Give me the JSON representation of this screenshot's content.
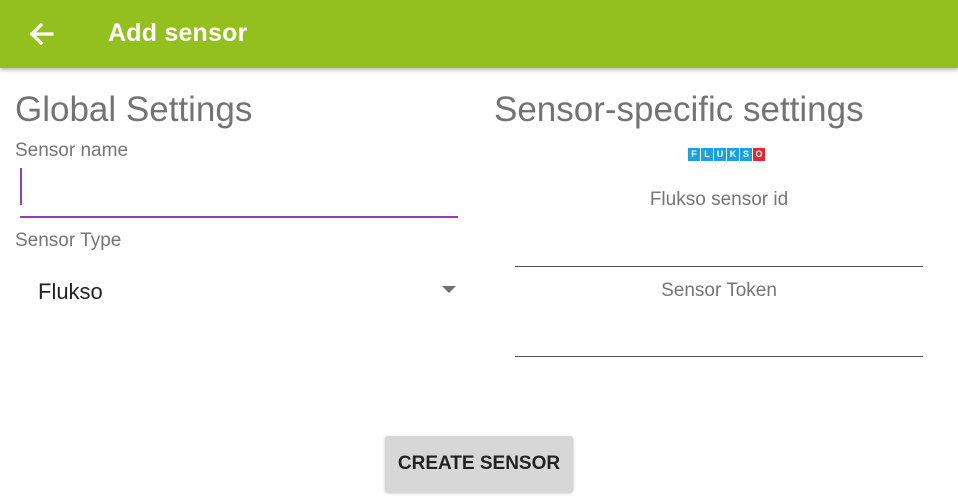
{
  "appbar": {
    "title": "Add sensor",
    "back_icon": "arrow-left-icon",
    "color": "#93c01f"
  },
  "global": {
    "heading": "Global Settings",
    "sensor_name_label": "Sensor name",
    "sensor_name_value": "",
    "sensor_type_label": "Sensor Type",
    "sensor_type_selected": "Flukso",
    "dropdown_icon": "triangle-down-icon"
  },
  "specific": {
    "heading": "Sensor-specific settings",
    "logo_letters": [
      "F",
      "L",
      "U",
      "K",
      "S",
      "O"
    ],
    "logo_colors": [
      "#1aa0e6",
      "#1aa0e6",
      "#1aa0e6",
      "#1aa0e6",
      "#1aa0e6",
      "#e8262d"
    ],
    "sensor_id_label": "Flukso sensor id",
    "sensor_id_value": "",
    "token_label": "Sensor Token",
    "token_value": ""
  },
  "actions": {
    "create_label": "CREATE SENSOR"
  },
  "colors": {
    "accent": "#8e3fbf",
    "text_secondary": "#757575"
  }
}
